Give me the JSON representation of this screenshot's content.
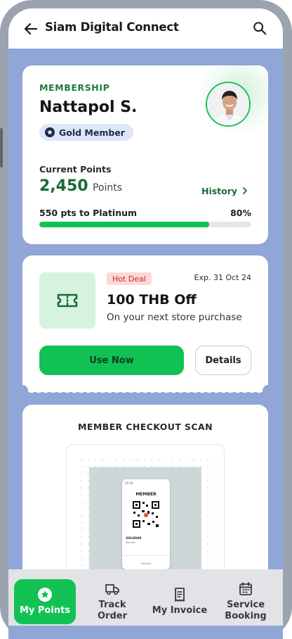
{
  "header": {
    "title": "Siam Digital Connect"
  },
  "membership": {
    "eyebrow": "MEMBERSHIP",
    "name": "Nattapol S.",
    "tier": "Gold Member",
    "points_label": "Current Points",
    "points_value": "2,450",
    "points_unit": "Points",
    "history_label": "History",
    "progress_text": "550 pts to Platinum",
    "progress_percent_label": "80%",
    "progress_fraction": 0.8
  },
  "coupon": {
    "badge": "Hot Deal",
    "expiry": "Exp. 31 Oct 24",
    "title": "100 THB Off",
    "subtitle": "On your next store purchase",
    "primary_label": "Use Now",
    "secondary_label": "Details"
  },
  "scan": {
    "title": "MEMBER CHECKOUT SCAN",
    "preview_title": "MEMBER",
    "preview_status": "10:30",
    "preview_row_title": "3OL8048",
    "preview_row_sub": "Member",
    "preview_footer": "Member"
  },
  "nav": {
    "items": [
      {
        "label": "My Points",
        "icon": "star-circle-icon",
        "active": true
      },
      {
        "label": "Track\nOrder",
        "icon": "truck-icon",
        "active": false
      },
      {
        "label": "My Invoice",
        "icon": "receipt-icon",
        "active": false
      },
      {
        "label": "Service\nBooking",
        "icon": "calendar-icon",
        "active": false
      }
    ]
  },
  "colors": {
    "accent_green": "#11c154",
    "dark_green": "#1a6b36",
    "screen_bg": "#8fa6d6",
    "badge_red": "#c0292a"
  }
}
